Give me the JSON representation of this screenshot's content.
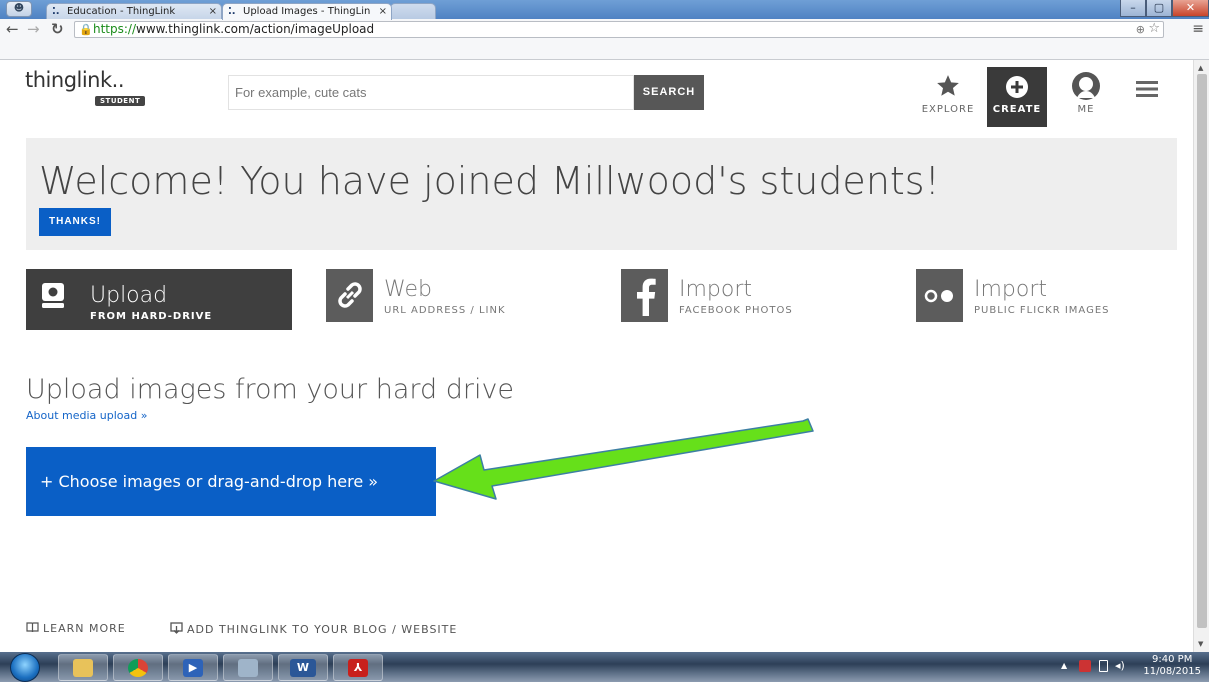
{
  "browser": {
    "tabs": [
      {
        "title": "Education - ThingLink",
        "active": false
      },
      {
        "title": "Upload Images - ThingLin",
        "active": true
      }
    ],
    "url_scheme": "https://",
    "url_rest": "www.thinglink.com/action/imageUpload"
  },
  "header": {
    "logo_text": "thinglink..",
    "badge": "STUDENT",
    "search_placeholder": "For example, cute cats",
    "search_label": "SEARCH",
    "nav": [
      {
        "label": "EXPLORE",
        "icon": "star-icon"
      },
      {
        "label": "CREATE",
        "icon": "plus-circle-icon"
      },
      {
        "label": "ME",
        "icon": "user-avatar-icon"
      }
    ]
  },
  "banner": {
    "title": "Welcome! You have joined Millwood's students!",
    "button": "THANKS!"
  },
  "options": [
    {
      "title": "Upload",
      "subtitle": "FROM HARD-DRIVE",
      "icon": "hard-drive-icon",
      "active": true
    },
    {
      "title": "Web",
      "subtitle": "URL ADDRESS / LINK",
      "icon": "link-icon",
      "active": false
    },
    {
      "title": "Import",
      "subtitle": "FACEBOOK PHOTOS",
      "icon": "facebook-icon",
      "active": false
    },
    {
      "title": "Import",
      "subtitle": "PUBLIC FLICKR IMAGES",
      "icon": "flickr-icon",
      "active": false
    }
  ],
  "upload": {
    "title": "Upload images from your hard drive",
    "about_link": "About media upload »",
    "choose_button": "+ Choose images or drag-and-drop here »"
  },
  "footer": {
    "learn_more": "LEARN MORE",
    "add_to_blog": "ADD THINGLINK TO YOUR BLOG / WEBSITE"
  },
  "taskbar": {
    "time": "9:40 PM",
    "date": "11/08/2015"
  },
  "colors": {
    "accent_blue": "#0a5fc6",
    "dark_tile": "#3f3f3f",
    "arrow_green": "#66e01a"
  }
}
